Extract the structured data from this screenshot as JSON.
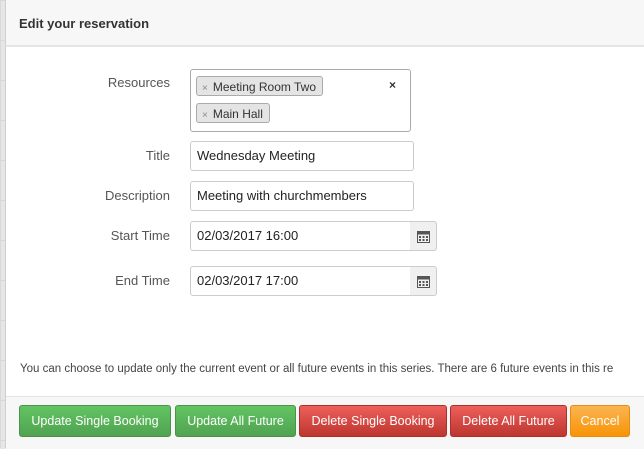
{
  "dialog": {
    "title": "Edit your reservation"
  },
  "form": {
    "resources": {
      "label": "Resources",
      "chips": [
        "Meeting Room Two",
        "Main Hall"
      ],
      "remove_glyph": "×",
      "clear_glyph": "×"
    },
    "title": {
      "label": "Title",
      "value": "Wednesday Meeting"
    },
    "description": {
      "label": "Description",
      "value": "Meeting with churchmembers"
    },
    "start_time": {
      "label": "Start Time",
      "value": "02/03/2017 16:00"
    },
    "end_time": {
      "label": "End Time",
      "value": "02/03/2017 17:00"
    }
  },
  "info_text": "You can choose to update only the current event or all future events in this series. There are 6 future events in this re",
  "footer": {
    "update_single": "Update Single Booking",
    "update_all": "Update All Future",
    "delete_single": "Delete Single Booking",
    "delete_all": "Delete All Future",
    "cancel": "Cancel"
  },
  "colors": {
    "success": "#5bb75b",
    "danger": "#da4f49",
    "warning": "#faa732"
  },
  "icons": {
    "calendar": "calendar-icon"
  }
}
